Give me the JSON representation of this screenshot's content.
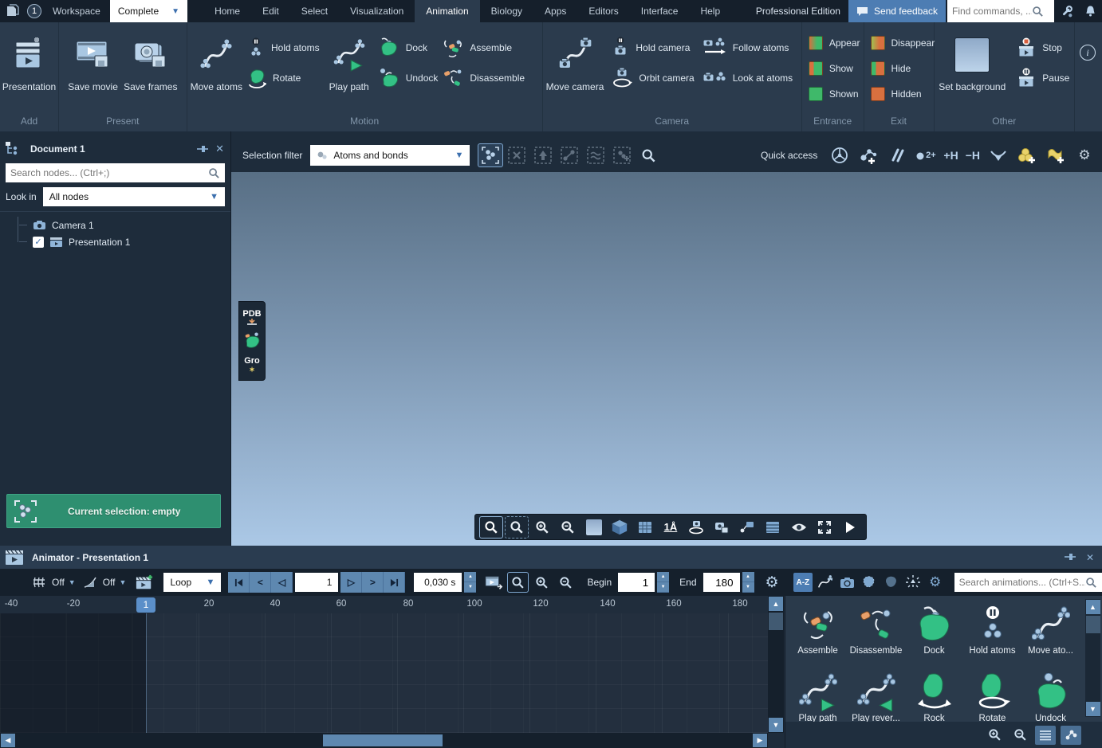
{
  "icons": {
    "dropdown": "▼",
    "close": "✕",
    "check": "✓",
    "spin_up": "▲",
    "spin_down": "▼",
    "left": "◀",
    "right": "▶",
    "up": "▲",
    "down": "▼",
    "step_back": "<",
    "step_fwd": ">",
    "play": "▷",
    "play_back": "◁",
    "gear": "⚙",
    "info": "i",
    "sparkle": "✶"
  },
  "titlebar": {
    "badge_count": "1",
    "workspace_label": "Workspace",
    "workspace_mode": "Complete",
    "menus": [
      "Home",
      "Edit",
      "Select",
      "Visualization",
      "Animation",
      "Biology",
      "Apps",
      "Editors",
      "Interface",
      "Help"
    ],
    "active_menu": "Animation",
    "edition": "Professional Edition",
    "send_feedback_label": "Send feedback",
    "find_placeholder": "Find commands, ..."
  },
  "ribbon": {
    "add": {
      "group_label": "Add",
      "presentation": "Presentation"
    },
    "present": {
      "group_label": "Present",
      "save_movie": "Save movie",
      "save_frames": "Save frames"
    },
    "motion": {
      "group_label": "Motion",
      "move_atoms": "Move atoms",
      "hold_atoms": "Hold atoms",
      "rotate": "Rotate",
      "play_path": "Play path",
      "dock": "Dock",
      "undock": "Undock",
      "assemble": "Assemble",
      "disassemble": "Disassemble"
    },
    "camera": {
      "group_label": "Camera",
      "move_camera": "Move camera",
      "hold_camera": "Hold camera",
      "orbit_camera": "Orbit camera",
      "follow_atoms": "Follow atoms",
      "look_at_atoms": "Look at atoms"
    },
    "entrance": {
      "group_label": "Entrance",
      "appear": "Appear",
      "show": "Show",
      "shown": "Shown"
    },
    "exit": {
      "group_label": "Exit",
      "disappear": "Disappear",
      "hide": "Hide",
      "hidden": "Hidden"
    },
    "other": {
      "group_label": "Other",
      "set_background": "Set background",
      "stop": "Stop",
      "pause": "Pause"
    }
  },
  "document_panel": {
    "title": "Document 1",
    "search_placeholder": "Search nodes... (Ctrl+;)",
    "look_in_label": "Look in",
    "look_in_value": "All nodes",
    "nodes": [
      {
        "label": "Camera 1"
      },
      {
        "label": "Presentation 1",
        "checked": true
      }
    ],
    "selection_status": "Current selection: empty"
  },
  "viewport": {
    "selection_filter_label": "Selection filter",
    "selection_filter_value": "Atoms and bonds",
    "quick_access": {
      "label": "Quick access",
      "charge": "2+",
      "add_hydrogens": "+H",
      "remove_hydrogens": "−H"
    },
    "side_buttons": {
      "pdb": "PDB",
      "gro": "Gro"
    },
    "scale_indicator": "1Å",
    "colors": {
      "gradient_top": "#586f85",
      "gradient_bottom": "#abc8e6",
      "selection_green": "#2e8f70",
      "accent_blue": "#5b8fc9"
    }
  },
  "animator": {
    "title": "Animator - Presentation 1",
    "grid_mode": "Off",
    "interpolation_mode": "Off",
    "loop_mode": "Loop",
    "current_frame": "1",
    "frame_time": "0,030 s",
    "begin_label": "Begin",
    "begin_value": "1",
    "end_label": "End",
    "end_value": "180",
    "sort_label": "A-Z",
    "search_placeholder": "Search animations... (Ctrl+S...",
    "ruler_ticks": [
      "-40",
      "-20",
      "1",
      "20",
      "40",
      "60",
      "80",
      "100",
      "120",
      "140",
      "160",
      "180"
    ],
    "presets": [
      {
        "label": "Assemble"
      },
      {
        "label": "Disassemble"
      },
      {
        "label": "Dock"
      },
      {
        "label": "Hold atoms"
      },
      {
        "label": "Move ato..."
      },
      {
        "label": "Play path"
      },
      {
        "label": "Play rever..."
      },
      {
        "label": "Rock"
      },
      {
        "label": "Rotate"
      },
      {
        "label": "Undock"
      }
    ]
  }
}
